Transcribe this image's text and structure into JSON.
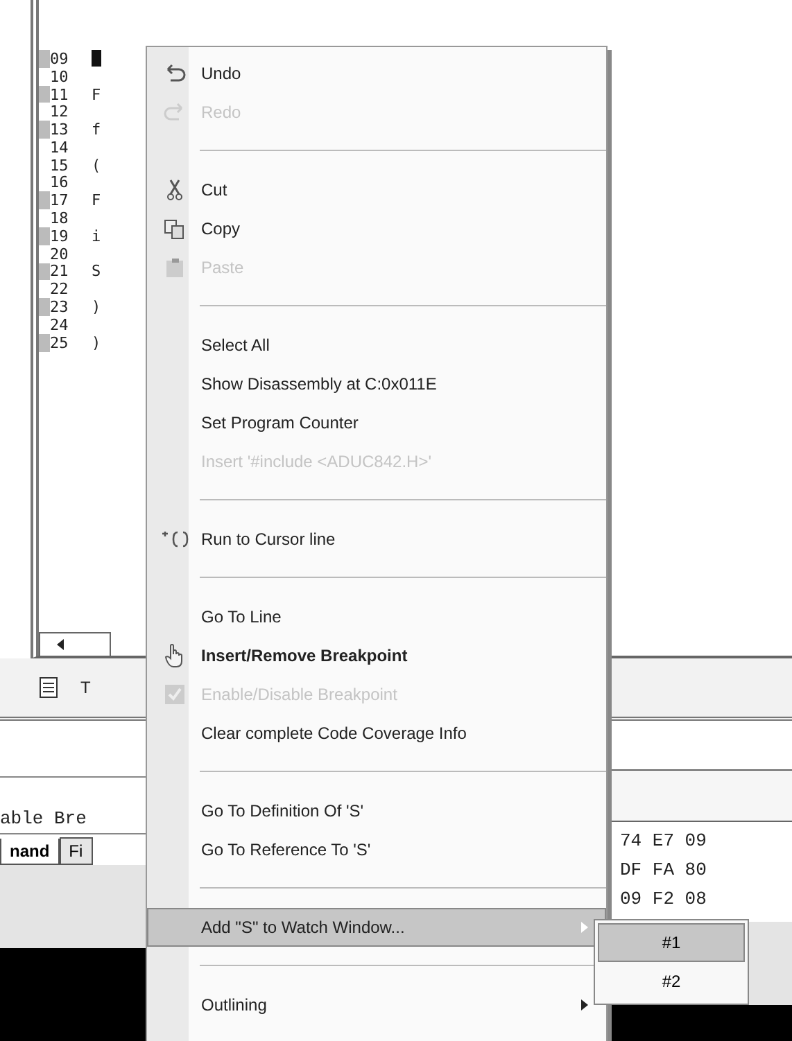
{
  "editor": {
    "lines": [
      {
        "number": "09",
        "cursor": true,
        "covered": true
      },
      {
        "number": "10",
        "cursor": false,
        "covered": false
      },
      {
        "number": "11",
        "code": "F",
        "cursor": false,
        "covered": true
      },
      {
        "number": "12",
        "cursor": false,
        "covered": false
      },
      {
        "number": "13",
        "code": "f",
        "cursor": false,
        "covered": true
      },
      {
        "number": "14",
        "cursor": false,
        "covered": false
      },
      {
        "number": "15",
        "code": "(",
        "cursor": false,
        "covered": false
      },
      {
        "number": "16",
        "cursor": false,
        "covered": false
      },
      {
        "number": "17",
        "code": "F",
        "cursor": false,
        "covered": true
      },
      {
        "number": "18",
        "cursor": false,
        "covered": false
      },
      {
        "number": "19",
        "code": "i",
        "cursor": false,
        "covered": true
      },
      {
        "number": "20",
        "cursor": false,
        "covered": false
      },
      {
        "number": "21",
        "code": "S",
        "cursor": false,
        "covered": true
      },
      {
        "number": "22",
        "cursor": false,
        "covered": false
      },
      {
        "number": "23",
        "code": ")",
        "cursor": false,
        "covered": true
      },
      {
        "number": "24",
        "cursor": false,
        "covered": false
      },
      {
        "number": "25",
        "code": ")",
        "cursor": false,
        "covered": true
      }
    ],
    "tab_label": "T"
  },
  "command": {
    "text": "able Bre",
    "tabs": [
      {
        "label": "nand",
        "selected": true
      },
      {
        "label": "Fi",
        "selected": false
      }
    ]
  },
  "memory": {
    "rows": [
      "74 E7 09",
      "DF FA 80",
      "09 F2 08"
    ]
  },
  "context_menu": {
    "items": [
      {
        "kind": "item",
        "label": "Undo",
        "disabled": false,
        "bold": false,
        "submenu": false,
        "selected": false
      },
      {
        "kind": "item",
        "label": "Redo",
        "disabled": true,
        "bold": false,
        "submenu": false,
        "selected": false
      },
      {
        "kind": "separator"
      },
      {
        "kind": "item",
        "label": "Cut",
        "disabled": false,
        "bold": false,
        "submenu": false,
        "selected": false
      },
      {
        "kind": "item",
        "label": "Copy",
        "disabled": false,
        "bold": false,
        "submenu": false,
        "selected": false
      },
      {
        "kind": "item",
        "label": "Paste",
        "disabled": true,
        "bold": false,
        "submenu": false,
        "selected": false
      },
      {
        "kind": "separator"
      },
      {
        "kind": "item",
        "label": "Select All",
        "disabled": false,
        "bold": false,
        "submenu": false,
        "selected": false
      },
      {
        "kind": "item",
        "label": "Show Disassembly at C:0x011E",
        "disabled": false,
        "bold": false,
        "submenu": false,
        "selected": false
      },
      {
        "kind": "item",
        "label": "Set Program Counter",
        "disabled": false,
        "bold": false,
        "submenu": false,
        "selected": false
      },
      {
        "kind": "item",
        "label": "Insert '#include <ADUC842.H>'",
        "disabled": true,
        "bold": false,
        "submenu": false,
        "selected": false
      },
      {
        "kind": "separator"
      },
      {
        "kind": "item",
        "label": "Run to Cursor line",
        "disabled": false,
        "bold": false,
        "submenu": false,
        "selected": false
      },
      {
        "kind": "separator"
      },
      {
        "kind": "item",
        "label": "Go To Line",
        "disabled": false,
        "bold": false,
        "submenu": false,
        "selected": false
      },
      {
        "kind": "item",
        "label": "Insert/Remove Breakpoint",
        "disabled": false,
        "bold": true,
        "submenu": false,
        "selected": false
      },
      {
        "kind": "item",
        "label": "Enable/Disable Breakpoint",
        "disabled": true,
        "bold": false,
        "submenu": false,
        "selected": false
      },
      {
        "kind": "item",
        "label": "Clear complete Code Coverage Info",
        "disabled": false,
        "bold": false,
        "submenu": false,
        "selected": false
      },
      {
        "kind": "separator"
      },
      {
        "kind": "item",
        "label": "Go To Definition Of 'S'",
        "disabled": false,
        "bold": false,
        "submenu": false,
        "selected": false
      },
      {
        "kind": "item",
        "label": "Go To Reference To 'S'",
        "disabled": false,
        "bold": false,
        "submenu": false,
        "selected": false
      },
      {
        "kind": "separator"
      },
      {
        "kind": "item",
        "label": "Add \"S\" to Watch Window...",
        "disabled": false,
        "bold": false,
        "submenu": true,
        "selected": true
      },
      {
        "kind": "separator"
      },
      {
        "kind": "item",
        "label": "Outlining",
        "disabled": false,
        "bold": false,
        "submenu": true,
        "selected": false
      }
    ]
  },
  "submenu": {
    "items": [
      {
        "label": "#1",
        "selected": true
      },
      {
        "label": "#2",
        "selected": false
      }
    ]
  }
}
